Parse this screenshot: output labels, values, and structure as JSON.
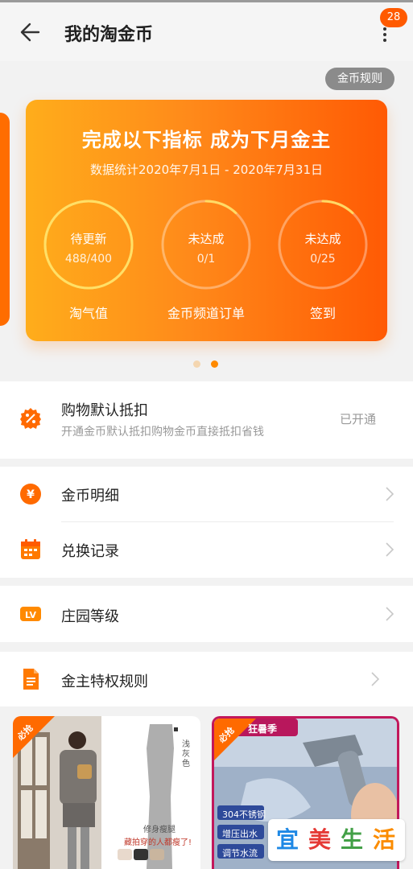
{
  "header": {
    "title": "我的淘金币",
    "badge": "28"
  },
  "rules_button": "金币规则",
  "card": {
    "title": "完成以下指标 成为下月金主",
    "subtitle": "数据统计2020年7月1日 - 2020年7月31日",
    "metrics": [
      {
        "status": "待更新",
        "value": "488/400",
        "label": "淘气值",
        "progress": 1.0
      },
      {
        "status": "未达成",
        "value": "0/1",
        "label": "金币频道订单",
        "progress": 0.0
      },
      {
        "status": "未达成",
        "value": "0/25",
        "label": "签到",
        "progress": 0.0
      }
    ]
  },
  "pager": {
    "count": 2,
    "active": 2
  },
  "deduction": {
    "title": "购物默认抵扣",
    "desc": "开通金币默认抵扣购物金币直接抵扣省钱",
    "status": "已开通"
  },
  "menu": {
    "coin_detail": "金币明细",
    "exchange_record": "兑换记录",
    "manor_level": "庄园等级",
    "privilege_rules": "金主特权规则"
  },
  "products": [
    {
      "tag": "必抢",
      "caption_color": "浅灰色",
      "caption_1": "修身瘦腿",
      "caption_2": "藏拍穿的人都瘦了!"
    },
    {
      "tag": "必抢",
      "badge": "狂暑季",
      "caption_1": "304不锈钢",
      "caption_2": "增压出水",
      "caption_3": "调节水流"
    }
  ],
  "watermark": [
    "宜",
    "美",
    "生",
    "活"
  ],
  "colors": {
    "accent": "#ff5a00",
    "card_start": "#ffad1b",
    "card_end": "#ff5a04"
  }
}
